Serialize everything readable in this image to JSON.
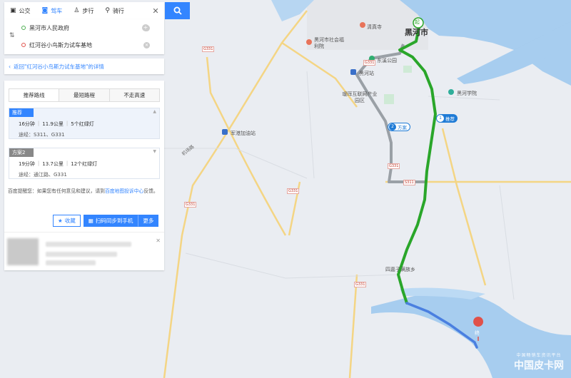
{
  "tabs": [
    {
      "label": "公交",
      "icon": "bus-icon"
    },
    {
      "label": "驾车",
      "icon": "car-icon"
    },
    {
      "label": "步行",
      "icon": "walk-icon"
    },
    {
      "label": "骑行",
      "icon": "bike-icon"
    }
  ],
  "active_tab": "驾车",
  "inputs": {
    "start": "黑河市人民政府",
    "end": "红河谷小鸟斯力试车基地"
  },
  "back_link": "返回\"红河谷小鸟斯力试车基地\"的详情",
  "route_tabs": [
    "推荐路线",
    "最短路程",
    "不走高速"
  ],
  "plans": [
    {
      "tag": "推荐",
      "time": "16分钟",
      "distance": "11.9公里",
      "lights": "5个红绿灯",
      "via": "途经：S311、G331"
    },
    {
      "tag": "方案2",
      "time": "19分钟",
      "distance": "13.7公里",
      "lights": "12个红绿灯",
      "via": "途经：通江路、G331"
    }
  ],
  "tip": {
    "prefix": "百度提醒您：如果您有任何意见和建议，请到",
    "link": "百度地图投诉中心",
    "suffix": "反馈。"
  },
  "actions": {
    "save": "收藏",
    "send": "扫码同步到手机",
    "more": "更多"
  },
  "map": {
    "city": "黑河市",
    "start_badge": "起",
    "end_badge": "终",
    "labels": {
      "temple": "清真寺",
      "welfare": "黑河市社会福利院",
      "park": "东溪公园",
      "station": "黑河站",
      "industrial": "瑷珲互联网产业园区",
      "college": "黑河学院",
      "gas": "军港加油站",
      "airport_road": "机场路",
      "township": "四嘉子满族乡"
    },
    "route_tags": {
      "recommended": {
        "num": "1",
        "text": "推荐"
      },
      "alternative": {
        "num": "2",
        "text": "方案"
      }
    },
    "shields": [
      "G331",
      "G331",
      "G331",
      "G331",
      "G331",
      "S311",
      "G331"
    ],
    "colors": {
      "main_route": "#2aa62a",
      "alt_route": "#9aa0a6",
      "final_leg": "#4a7fe0",
      "water": "#9fc8ef",
      "road": "#f7d77a",
      "land": "#eceff4"
    }
  },
  "watermark": {
    "small": "中国畅销车资讯平台",
    "big": "中国皮卡网"
  }
}
